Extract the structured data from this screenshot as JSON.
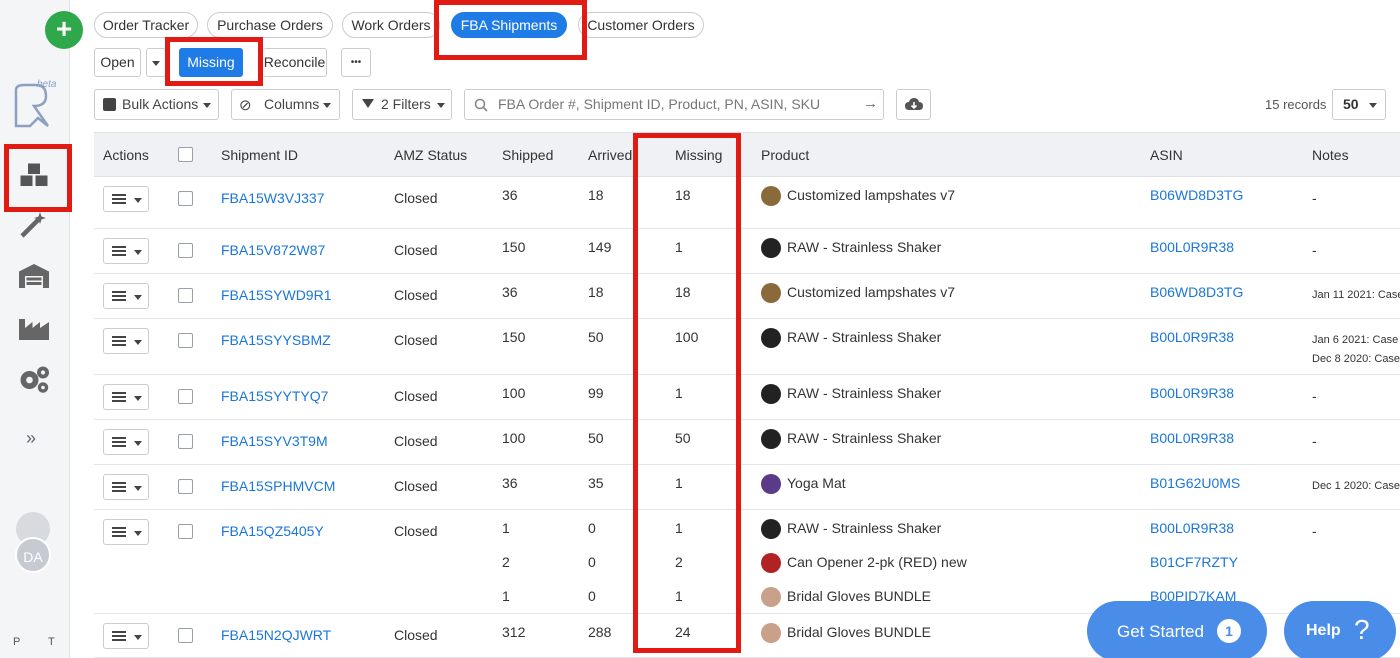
{
  "sidebar": {
    "add_label": "+",
    "beta_label": "beta",
    "expand_label": "»",
    "avatar_initials": "DA",
    "footer_left": "P",
    "footer_right": "T"
  },
  "tabs": [
    "Order Tracker",
    "Purchase Orders",
    "Work Orders",
    "FBA Shipments",
    "Customer Orders"
  ],
  "subtabs": {
    "open": "Open",
    "missing": "Missing",
    "reconcile": "Reconcile",
    "more": "•••"
  },
  "toolbar": {
    "bulk_actions": "Bulk Actions",
    "columns": "Columns",
    "filters": "2 Filters",
    "search_placeholder": "FBA Order #, Shipment ID, Product, PN, ASIN, SKU",
    "records": "15 records",
    "per_page": "50"
  },
  "table": {
    "headers": {
      "actions": "Actions",
      "shipment_id": "Shipment ID",
      "amz_status": "AMZ Status",
      "shipped": "Shipped",
      "arrived": "Arrived",
      "missing": "Missing",
      "product": "Product",
      "asin": "ASIN",
      "notes": "Notes"
    },
    "rows": [
      {
        "id": "FBA15W3VJ337",
        "status": "Closed",
        "lines": [
          {
            "shipped": "36",
            "arrived": "18",
            "missing": "18",
            "product": "Customized lampshates v7",
            "asin": "B06WD8D3TG"
          }
        ],
        "notes": [
          "-"
        ]
      },
      {
        "id": "FBA15V872W87",
        "status": "Closed",
        "lines": [
          {
            "shipped": "150",
            "arrived": "149",
            "missing": "1",
            "product": "RAW - Strainless Shaker",
            "asin": "B00L0R9R38"
          }
        ],
        "notes": [
          "-"
        ]
      },
      {
        "id": "FBA15SYWD9R1",
        "status": "Closed",
        "lines": [
          {
            "shipped": "36",
            "arrived": "18",
            "missing": "18",
            "product": "Customized lampshates v7",
            "asin": "B06WD8D3TG"
          }
        ],
        "notes": [
          "Jan 11 2021: Case"
        ]
      },
      {
        "id": "FBA15SYYSBMZ",
        "status": "Closed",
        "lines": [
          {
            "shipped": "150",
            "arrived": "50",
            "missing": "100",
            "product": "RAW - Strainless Shaker",
            "asin": "B00L0R9R38"
          }
        ],
        "notes": [
          "Jan 6 2021: Case",
          "Dec 8 2020: Case"
        ]
      },
      {
        "id": "FBA15SYYTYQ7",
        "status": "Closed",
        "lines": [
          {
            "shipped": "100",
            "arrived": "99",
            "missing": "1",
            "product": "RAW - Strainless Shaker",
            "asin": "B00L0R9R38"
          }
        ],
        "notes": [
          "-"
        ]
      },
      {
        "id": "FBA15SYV3T9M",
        "status": "Closed",
        "lines": [
          {
            "shipped": "100",
            "arrived": "50",
            "missing": "50",
            "product": "RAW - Strainless Shaker",
            "asin": "B00L0R9R38"
          }
        ],
        "notes": [
          "-"
        ]
      },
      {
        "id": "FBA15SPHMVCM",
        "status": "Closed",
        "lines": [
          {
            "shipped": "36",
            "arrived": "35",
            "missing": "1",
            "product": "Yoga Mat",
            "asin": "B01G62U0MS"
          }
        ],
        "notes": [
          "Dec 1 2020: Case"
        ]
      },
      {
        "id": "FBA15QZ5405Y",
        "status": "Closed",
        "lines": [
          {
            "shipped": "1",
            "arrived": "0",
            "missing": "1",
            "product": "RAW - Strainless Shaker",
            "asin": "B00L0R9R38"
          },
          {
            "shipped": "2",
            "arrived": "0",
            "missing": "2",
            "product": "Can Opener 2-pk (RED) new",
            "asin": "B01CF7RZTY"
          },
          {
            "shipped": "1",
            "arrived": "0",
            "missing": "1",
            "product": "Bridal Gloves BUNDLE",
            "asin": "B00PID7KAM"
          }
        ],
        "notes": [
          "-"
        ]
      },
      {
        "id": "FBA15N2QJWRT",
        "status": "Closed",
        "lines": [
          {
            "shipped": "312",
            "arrived": "288",
            "missing": "24",
            "product": "Bridal Gloves BUNDLE",
            "asin": ""
          }
        ],
        "notes": []
      }
    ]
  },
  "floating": {
    "get_started": "Get Started",
    "get_started_badge": "1",
    "help": "Help",
    "help_icon": "?"
  },
  "colors": {
    "accent": "#1f7be6",
    "link": "#1b76d9",
    "highlight": "#e11b14",
    "add": "#2ea84a",
    "floating": "#4a8de8"
  }
}
